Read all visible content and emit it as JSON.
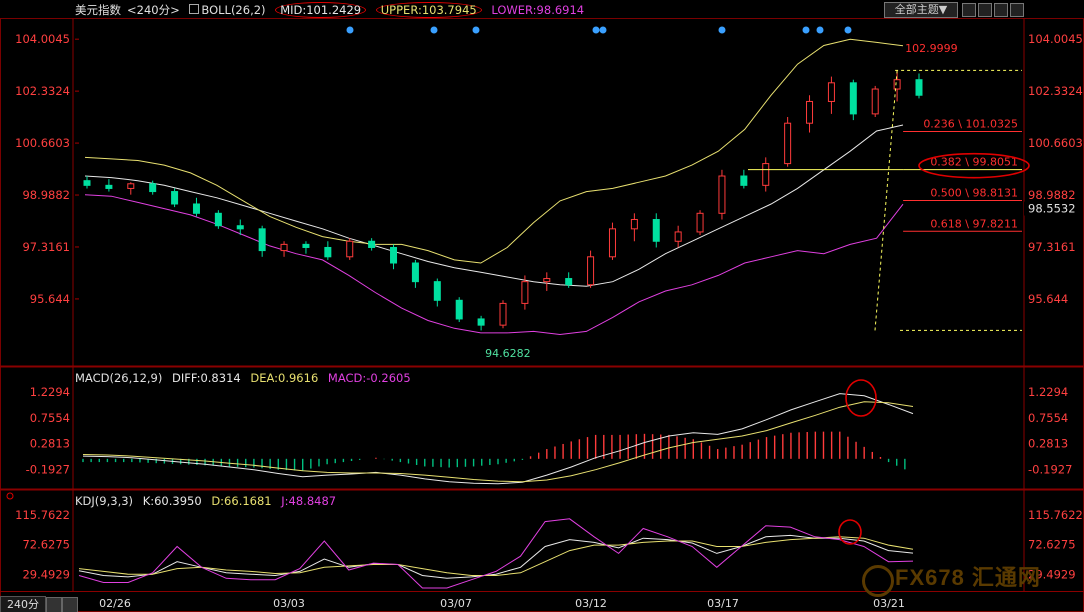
{
  "header": {
    "instrument": "美元指数",
    "period": "<240分>",
    "indicator": "BOLL(26,2)",
    "mid": "MID:101.2429",
    "upper": "UPPER:103.7945",
    "lower": "LOWER:98.6914",
    "theme_button": "全部主题▼"
  },
  "macd_header": {
    "name": "MACD(26,12,9)",
    "diff": "DIFF:0.8314",
    "dea": "DEA:0.9616",
    "macd": "MACD:-0.2605"
  },
  "kdj_header": {
    "name": "KDJ(9,3,3)",
    "k": "K:60.3950",
    "d": "D:66.1681",
    "j": "J:48.8487"
  },
  "footer": {
    "period_label": "240分",
    "watermark": "FX678 汇通网"
  },
  "colors": {
    "up": "#ff3b3b",
    "down": "#00e0a0",
    "mid": "#e8e8e8",
    "upper": "#e8e070",
    "lower": "#e040e0",
    "fib": "#ff3030",
    "axis_text": "#ff4040"
  },
  "chart_data": [
    {
      "type": "candlestick",
      "title": "美元指数 <240分> BOLL(26,2)",
      "x": [
        "02/26",
        "03/03",
        "03/07",
        "03/12",
        "03/17",
        "03/21"
      ],
      "y_ticks": [
        95.644,
        97.3161,
        98.9882,
        100.6603,
        102.3324,
        104.0045
      ],
      "ylim": [
        94.0,
        104.3
      ],
      "last_price": "98.5532",
      "annotations": {
        "high": "102.9999",
        "low": "94.6282"
      },
      "fibonacci": [
        {
          "label": "0.236 \\ 101.0325",
          "value": 101.0325
        },
        {
          "label": "0.382 \\ 99.8051",
          "value": 99.8051
        },
        {
          "label": "0.500 \\ 98.8131",
          "value": 98.8131
        },
        {
          "label": "0.618 \\ 97.8211",
          "value": 97.8211
        }
      ],
      "series": [
        {
          "name": "MID",
          "values": [
            99.6,
            99.55,
            99.45,
            99.3,
            99.1,
            98.9,
            98.65,
            98.4,
            98.15,
            97.9,
            97.6,
            97.35,
            97.1,
            96.85,
            96.65,
            96.5,
            96.35,
            96.2,
            96.1,
            96.05,
            96.2,
            96.6,
            97.1,
            97.5,
            97.9,
            98.3,
            98.7,
            99.2,
            99.8,
            100.4,
            101.05,
            101.2429
          ]
        },
        {
          "name": "UPPER",
          "values": [
            100.2,
            100.15,
            100.1,
            99.95,
            99.7,
            99.3,
            98.8,
            98.3,
            97.95,
            97.65,
            97.5,
            97.4,
            97.4,
            97.2,
            96.9,
            96.8,
            97.3,
            98.1,
            98.8,
            99.1,
            99.2,
            99.4,
            99.6,
            99.95,
            100.4,
            101.1,
            102.2,
            103.2,
            103.8,
            104.0,
            103.9,
            103.7945
          ]
        },
        {
          "name": "LOWER",
          "values": [
            99.0,
            98.95,
            98.75,
            98.55,
            98.35,
            98.05,
            97.7,
            97.35,
            97.1,
            96.9,
            96.4,
            95.85,
            95.35,
            94.95,
            94.7,
            94.55,
            94.55,
            94.6,
            94.5,
            94.6,
            95.05,
            95.55,
            95.9,
            96.1,
            96.4,
            96.8,
            97.0,
            97.2,
            97.1,
            97.4,
            97.6,
            98.6914
          ]
        }
      ],
      "candles": [
        {
          "o": 99.45,
          "h": 99.6,
          "l": 99.2,
          "c": 99.3
        },
        {
          "o": 99.3,
          "h": 99.5,
          "l": 99.1,
          "c": 99.2
        },
        {
          "o": 99.2,
          "h": 99.4,
          "l": 99.0,
          "c": 99.35
        },
        {
          "o": 99.35,
          "h": 99.45,
          "l": 99.0,
          "c": 99.1
        },
        {
          "o": 99.1,
          "h": 99.2,
          "l": 98.6,
          "c": 98.7
        },
        {
          "o": 98.7,
          "h": 98.9,
          "l": 98.3,
          "c": 98.4
        },
        {
          "o": 98.4,
          "h": 98.5,
          "l": 97.9,
          "c": 98.0
        },
        {
          "o": 98.0,
          "h": 98.2,
          "l": 97.7,
          "c": 97.9
        },
        {
          "o": 97.9,
          "h": 98.0,
          "l": 97.0,
          "c": 97.2
        },
        {
          "o": 97.2,
          "h": 97.5,
          "l": 97.0,
          "c": 97.4
        },
        {
          "o": 97.4,
          "h": 97.5,
          "l": 97.1,
          "c": 97.3
        },
        {
          "o": 97.3,
          "h": 97.5,
          "l": 96.9,
          "c": 97.0
        },
        {
          "o": 97.0,
          "h": 97.6,
          "l": 96.9,
          "c": 97.5
        },
        {
          "o": 97.5,
          "h": 97.6,
          "l": 97.2,
          "c": 97.3
        },
        {
          "o": 97.3,
          "h": 97.4,
          "l": 96.6,
          "c": 96.8
        },
        {
          "o": 96.8,
          "h": 96.9,
          "l": 96.0,
          "c": 96.2
        },
        {
          "o": 96.2,
          "h": 96.3,
          "l": 95.4,
          "c": 95.6
        },
        {
          "o": 95.6,
          "h": 95.7,
          "l": 94.9,
          "c": 95.0
        },
        {
          "o": 95.0,
          "h": 95.1,
          "l": 94.63,
          "c": 94.8
        },
        {
          "o": 94.8,
          "h": 95.6,
          "l": 94.7,
          "c": 95.5
        },
        {
          "o": 95.5,
          "h": 96.4,
          "l": 95.3,
          "c": 96.2
        },
        {
          "o": 96.2,
          "h": 96.5,
          "l": 95.9,
          "c": 96.3
        },
        {
          "o": 96.3,
          "h": 96.5,
          "l": 96.0,
          "c": 96.1
        },
        {
          "o": 96.1,
          "h": 97.2,
          "l": 96.0,
          "c": 97.0
        },
        {
          "o": 97.0,
          "h": 98.1,
          "l": 96.9,
          "c": 97.9
        },
        {
          "o": 97.9,
          "h": 98.4,
          "l": 97.5,
          "c": 98.2
        },
        {
          "o": 98.2,
          "h": 98.4,
          "l": 97.3,
          "c": 97.5
        },
        {
          "o": 97.5,
          "h": 98.0,
          "l": 97.3,
          "c": 97.8
        },
        {
          "o": 97.8,
          "h": 98.5,
          "l": 97.7,
          "c": 98.4
        },
        {
          "o": 98.4,
          "h": 99.8,
          "l": 98.2,
          "c": 99.6
        },
        {
          "o": 99.6,
          "h": 99.8,
          "l": 99.2,
          "c": 99.3
        },
        {
          "o": 99.3,
          "h": 100.2,
          "l": 99.1,
          "c": 100.0
        },
        {
          "o": 100.0,
          "h": 101.5,
          "l": 99.9,
          "c": 101.3
        },
        {
          "o": 101.3,
          "h": 102.2,
          "l": 101.0,
          "c": 102.0
        },
        {
          "o": 102.0,
          "h": 102.8,
          "l": 101.6,
          "c": 102.6
        },
        {
          "o": 102.6,
          "h": 102.7,
          "l": 101.4,
          "c": 101.6
        },
        {
          "o": 101.6,
          "h": 102.5,
          "l": 101.5,
          "c": 102.4
        },
        {
          "o": 102.4,
          "h": 103.0,
          "l": 102.0,
          "c": 102.7
        },
        {
          "o": 102.7,
          "h": 102.9,
          "l": 102.1,
          "c": 102.2
        }
      ]
    },
    {
      "type": "line",
      "title": "MACD(26,12,9)",
      "y_ticks": [
        -0.1927,
        0.2813,
        0.7554,
        1.2294
      ],
      "ylim": [
        -0.5,
        1.45
      ],
      "series": [
        {
          "name": "DIFF",
          "values": [
            0.05,
            0.04,
            0.02,
            -0.02,
            -0.06,
            -0.1,
            -0.15,
            -0.2,
            -0.27,
            -0.33,
            -0.3,
            -0.28,
            -0.25,
            -0.3,
            -0.37,
            -0.42,
            -0.45,
            -0.46,
            -0.43,
            -0.3,
            -0.15,
            0.02,
            0.15,
            0.3,
            0.42,
            0.48,
            0.45,
            0.55,
            0.72,
            0.9,
            1.05,
            1.2,
            1.16,
            1.0,
            0.8314
          ]
        },
        {
          "name": "DEA",
          "values": [
            0.08,
            0.07,
            0.05,
            0.02,
            -0.01,
            -0.04,
            -0.08,
            -0.12,
            -0.17,
            -0.22,
            -0.25,
            -0.26,
            -0.26,
            -0.27,
            -0.3,
            -0.34,
            -0.38,
            -0.41,
            -0.42,
            -0.39,
            -0.31,
            -0.2,
            -0.07,
            0.07,
            0.2,
            0.3,
            0.36,
            0.42,
            0.52,
            0.66,
            0.8,
            0.95,
            1.05,
            1.03,
            0.9616
          ]
        },
        {
          "name": "MACD",
          "values": [
            -0.06,
            -0.06,
            -0.06,
            -0.08,
            -0.1,
            -0.12,
            -0.14,
            -0.16,
            -0.2,
            -0.22,
            -0.1,
            -0.04,
            0.02,
            -0.06,
            -0.14,
            -0.16,
            -0.14,
            -0.1,
            -0.02,
            0.18,
            0.32,
            0.44,
            0.44,
            0.46,
            0.44,
            0.36,
            0.18,
            0.26,
            0.4,
            0.48,
            0.5,
            0.5,
            0.22,
            -0.06,
            -0.2605
          ]
        }
      ]
    },
    {
      "type": "line",
      "title": "KDJ(9,3,3)",
      "y_ticks": [
        29.4929,
        72.6275,
        115.7622
      ],
      "ylim": [
        10,
        130
      ],
      "series": [
        {
          "name": "K",
          "values": [
            35,
            28,
            26,
            30,
            48,
            40,
            32,
            30,
            28,
            34,
            52,
            40,
            45,
            44,
            28,
            24,
            26,
            30,
            40,
            70,
            80,
            76,
            68,
            82,
            80,
            75,
            60,
            70,
            84,
            86,
            82,
            82,
            78,
            64,
            60.395
          ]
        },
        {
          "name": "D",
          "values": [
            38,
            34,
            30,
            30,
            38,
            40,
            36,
            34,
            31,
            32,
            40,
            42,
            44,
            44,
            38,
            32,
            28,
            28,
            32,
            48,
            64,
            72,
            72,
            76,
            78,
            78,
            70,
            70,
            76,
            80,
            82,
            84,
            82,
            72,
            66.168
          ]
        },
        {
          "name": "J",
          "values": [
            28,
            18,
            18,
            32,
            70,
            40,
            24,
            22,
            22,
            38,
            78,
            36,
            46,
            44,
            10,
            10,
            22,
            34,
            56,
            106,
            110,
            84,
            60,
            96,
            84,
            70,
            40,
            70,
            100,
            98,
            84,
            80,
            70,
            48,
            48.849
          ]
        }
      ]
    }
  ]
}
